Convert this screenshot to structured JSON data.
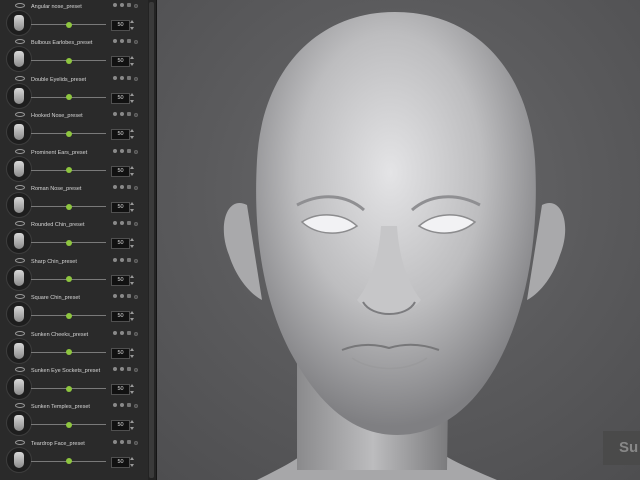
{
  "presets": [
    {
      "label": "Angular nose_preset",
      "value": "50",
      "level": 0.5
    },
    {
      "label": "Bulbous Earlobes_preset",
      "value": "50",
      "level": 0.5
    },
    {
      "label": "Double Eyelids_preset",
      "value": "50",
      "level": 0.5
    },
    {
      "label": "Hooked Nose_preset",
      "value": "50",
      "level": 0.5
    },
    {
      "label": "Prominent Ears_preset",
      "value": "50",
      "level": 0.5
    },
    {
      "label": "Roman Nose_preset",
      "value": "50",
      "level": 0.5
    },
    {
      "label": "Rounded Chin_preset",
      "value": "50",
      "level": 0.5
    },
    {
      "label": "Sharp Chin_preset",
      "value": "50",
      "level": 0.5
    },
    {
      "label": "Square Chin_preset",
      "value": "50",
      "level": 0.5
    },
    {
      "label": "Sunken Cheeks_preset",
      "value": "50",
      "level": 0.5
    },
    {
      "label": "Sunken Eye Sockets_preset",
      "value": "50",
      "level": 0.5
    },
    {
      "label": "Sunken Temples_preset",
      "value": "50",
      "level": 0.5
    },
    {
      "label": "Teardrop Face_preset",
      "value": "50",
      "level": 0.5
    }
  ],
  "viewport": {
    "overlay_button_label": "Su"
  },
  "colors": {
    "slider_knob": "#8ec63f",
    "panel_bg": "#2a2a2a",
    "viewport_bg": "#58585a"
  }
}
